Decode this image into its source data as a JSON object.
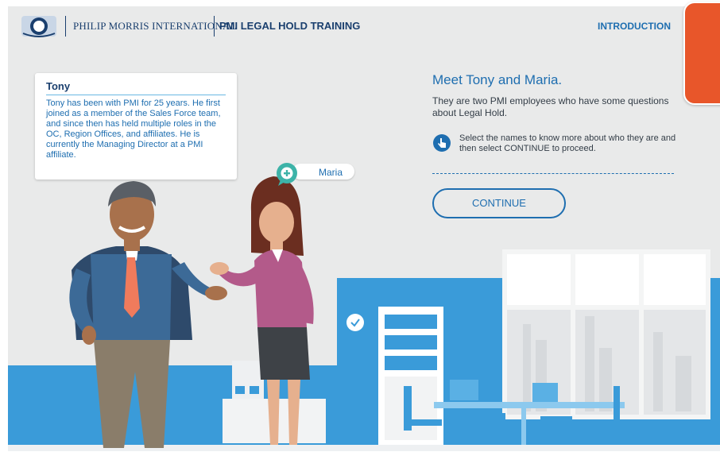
{
  "header": {
    "brand": "PHILIP MORRIS INTERNATIONAL",
    "course_title": "PMI LEGAL HOLD TRAINING",
    "section": "INTRODUCTION"
  },
  "characters": {
    "tony": {
      "name": "Tony",
      "bio": "Tony has been with PMI for 25 years. He first joined as a member of the Sales Force team, and since then has held multiple roles in the OC, Region Offices, and affiliates. He is currently the Managing Director at a PMI affiliate."
    },
    "maria": {
      "name": "Maria"
    }
  },
  "content": {
    "heading": "Meet Tony and Maria.",
    "paragraph": "They are two PMI employees who have some questions about Legal Hold.",
    "instruction": "Select the names to know more about who they are and then select CONTINUE to proceed.",
    "continue_label": "CONTINUE"
  },
  "colors": {
    "accent_blue": "#1e6eb0",
    "wall_blue": "#3a9bd9",
    "menu_orange": "#e8562a",
    "background": "#e9eaea"
  },
  "icons": [
    "pmi-logo",
    "menu-tab",
    "plus-icon",
    "pointer-hand-icon",
    "clock-icon"
  ]
}
